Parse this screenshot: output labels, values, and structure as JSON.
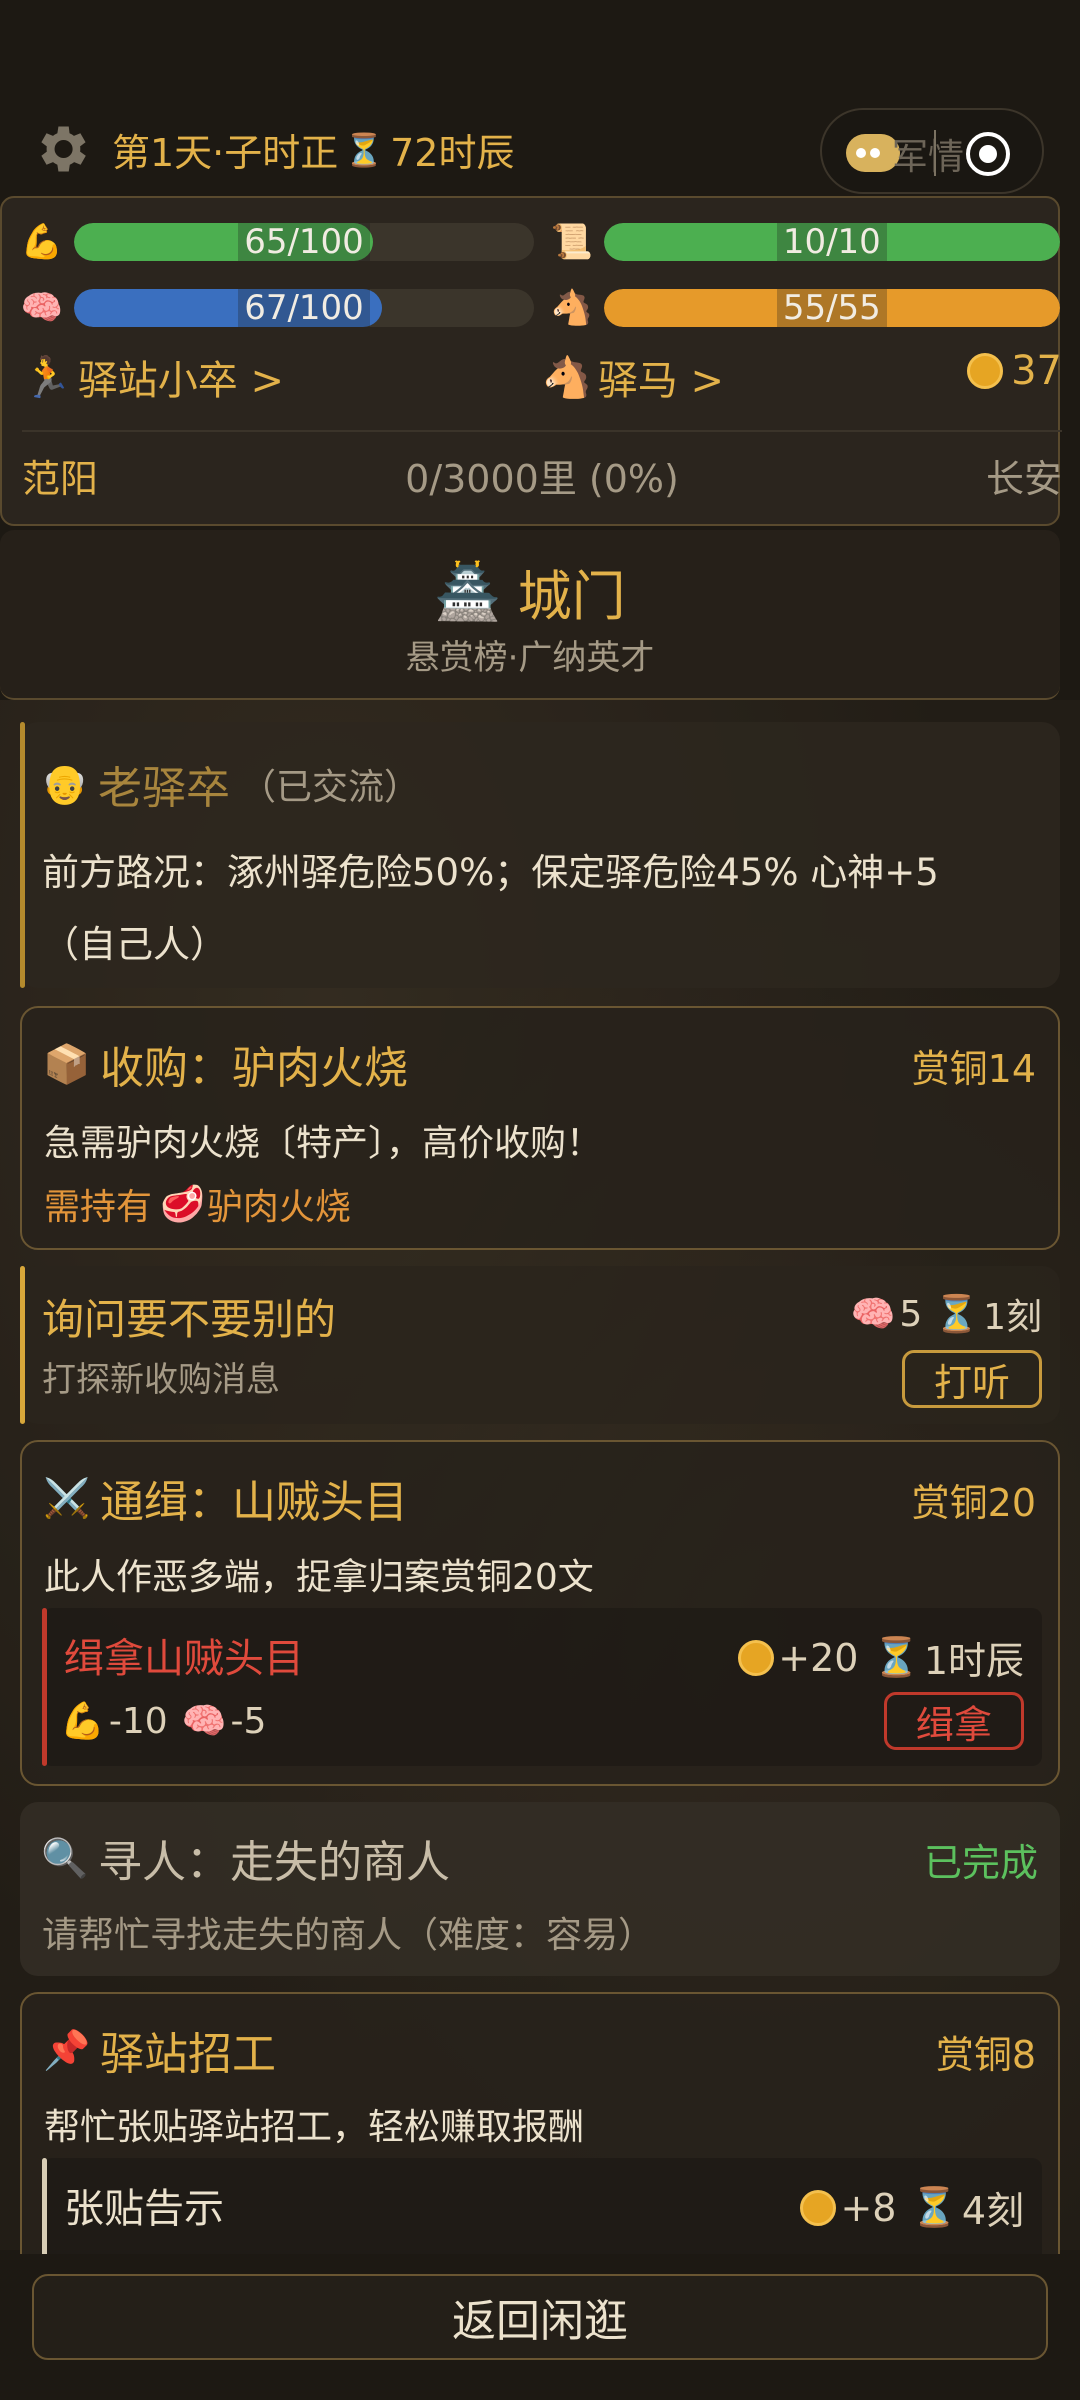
{
  "header": {
    "day_time": "第1天·子时正",
    "hourglass_icon": "hourglass-icon",
    "hours_left": "72时辰",
    "capsule_text": "军情"
  },
  "stats": {
    "strength": {
      "icon": "flexed-biceps-icon",
      "label": "65/100",
      "value": 65,
      "max": 100,
      "color": "#4caf50"
    },
    "scroll": {
      "icon": "scroll-icon",
      "label": "10/10",
      "value": 10,
      "max": 10,
      "color": "#4caf50"
    },
    "mind": {
      "icon": "brain-icon",
      "label": "67/100",
      "value": 67,
      "max": 100,
      "color": "#3a6fbf"
    },
    "horse": {
      "icon": "horse-icon",
      "label": "55/55",
      "value": 55,
      "max": 55,
      "color": "#e69a2a"
    }
  },
  "links": {
    "role": "驿站小卒 >",
    "mount": "驿马 >",
    "coins": "37"
  },
  "route": {
    "from": "范阳",
    "progress": "0/3000里 (0%)",
    "to": "长安"
  },
  "place": {
    "title": "城门",
    "subtitle": "悬赏榜·广纳英才"
  },
  "npc": {
    "name": "老驿卒",
    "status": "（已交流）",
    "text_line1": "前方路况：涿州驿危险50%；保定驿危险45% 心神+5",
    "text_line2": "（自己人）"
  },
  "quest_buy": {
    "title": "收购：驴肉火烧",
    "reward": "赏铜14",
    "desc": "急需驴肉火烧〔特产〕，高价收购！",
    "require_prefix": "需持有",
    "require_item": "驴肉火烧"
  },
  "ask": {
    "title": "询问要不要别的",
    "desc": "打探新收购消息",
    "cost_mind": "5",
    "cost_time": "1刻",
    "button": "打听"
  },
  "quest_wanted": {
    "title": "通缉：山贼头目",
    "reward": "赏铜20",
    "desc": "此人作恶多端，捉拿归案赏铜20文",
    "action_title": "缉拿山贼头目",
    "action_gain": "+20",
    "action_time": "1时辰",
    "action_cost_str": "-10",
    "action_cost_mind": "-5",
    "button": "缉拿"
  },
  "quest_find": {
    "title": "寻人：走失的商人",
    "status": "已完成",
    "desc": "请帮忙寻找走失的商人（难度：容易）"
  },
  "quest_recruit": {
    "title": "驿站招工",
    "reward": "赏铜8",
    "desc": "帮忙张贴驿站招工，轻松赚取报酬",
    "action_title": "张贴告示",
    "action_gain": "+8",
    "action_time": "4刻"
  },
  "footer": {
    "return_label": "返回闲逛"
  }
}
